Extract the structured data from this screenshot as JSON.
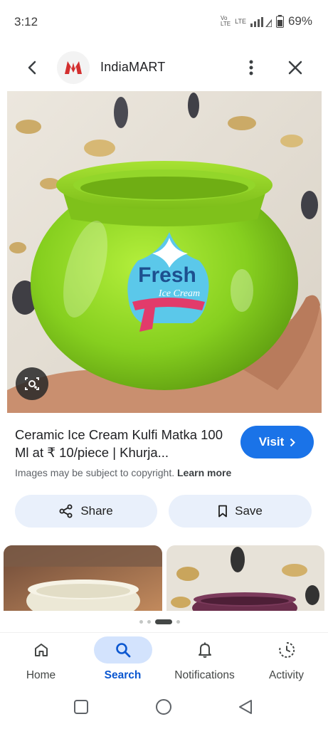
{
  "status_bar": {
    "time": "3:12",
    "battery": "69%",
    "net": "LTE"
  },
  "header": {
    "site_name": "IndiaMART"
  },
  "image": {
    "badge_line1": "Fresh",
    "badge_line2": "Ice Cream"
  },
  "result": {
    "title": "Ceramic Ice Cream Kulfi Matka 100 Ml at ₹ 10/piece | Khurja...",
    "visit_label": "Visit",
    "copyright_text": "Images may be subject to copyright.",
    "learn_more": "Learn more"
  },
  "actions": {
    "share_label": "Share",
    "save_label": "Save"
  },
  "bottom_nav": [
    {
      "label": "Home",
      "icon": "home-icon"
    },
    {
      "label": "Search",
      "icon": "search-icon"
    },
    {
      "label": "Notifications",
      "icon": "bell-icon"
    },
    {
      "label": "Activity",
      "icon": "activity-icon"
    }
  ],
  "colors": {
    "accent": "#1a73e8",
    "pill_bg": "#e9f0fb",
    "active_nav_bg": "#d3e3fd",
    "pot_green": "#8bd124"
  },
  "carousel": {
    "pages": 4,
    "active": 2
  }
}
